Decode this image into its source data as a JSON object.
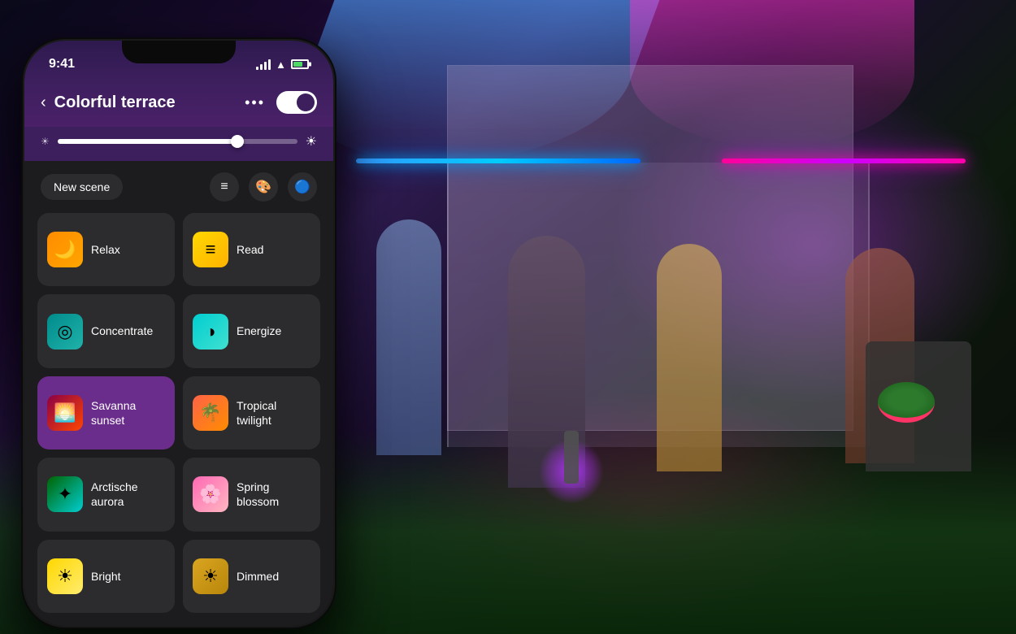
{
  "background": {
    "description": "Outdoor party scene at night with colorful lights"
  },
  "phone": {
    "status_bar": {
      "time": "9:41",
      "signal": "●●●",
      "wifi": "WiFi",
      "battery": "70%"
    },
    "header": {
      "back_label": "‹",
      "title": "Colorful terrace",
      "dots_label": "•••",
      "power_on": true
    },
    "toolbar": {
      "new_scene_label": "New scene"
    },
    "scenes": [
      {
        "id": "relax",
        "label": "Relax",
        "icon_type": "orange",
        "icon_char": "🌙",
        "active": false
      },
      {
        "id": "read",
        "label": "Read",
        "icon_type": "yellow",
        "icon_char": "☰",
        "active": false
      },
      {
        "id": "concentrate",
        "label": "Concentrate",
        "icon_type": "teal",
        "icon_char": "◎",
        "active": false
      },
      {
        "id": "energize",
        "label": "Energize",
        "icon_type": "cyan",
        "icon_char": "◑",
        "active": false
      },
      {
        "id": "savanna",
        "label": "Savanna sunset",
        "icon_type": "savanna",
        "icon_char": "🌅",
        "active": true
      },
      {
        "id": "tropical",
        "label": "Tropical twilight",
        "icon_type": "tropical",
        "icon_char": "🌴",
        "active": false
      },
      {
        "id": "aurora",
        "label": "Arctische aurora",
        "icon_type": "aurora",
        "icon_char": "✦",
        "active": false
      },
      {
        "id": "blossom",
        "label": "Spring blossom",
        "icon_type": "blossom",
        "icon_char": "🌸",
        "active": false
      },
      {
        "id": "bright",
        "label": "Bright",
        "icon_type": "bright",
        "icon_char": "☀",
        "active": false
      },
      {
        "id": "dimmed",
        "label": "Dimmed",
        "icon_type": "dimmed",
        "icon_char": "☀",
        "active": false
      }
    ]
  }
}
